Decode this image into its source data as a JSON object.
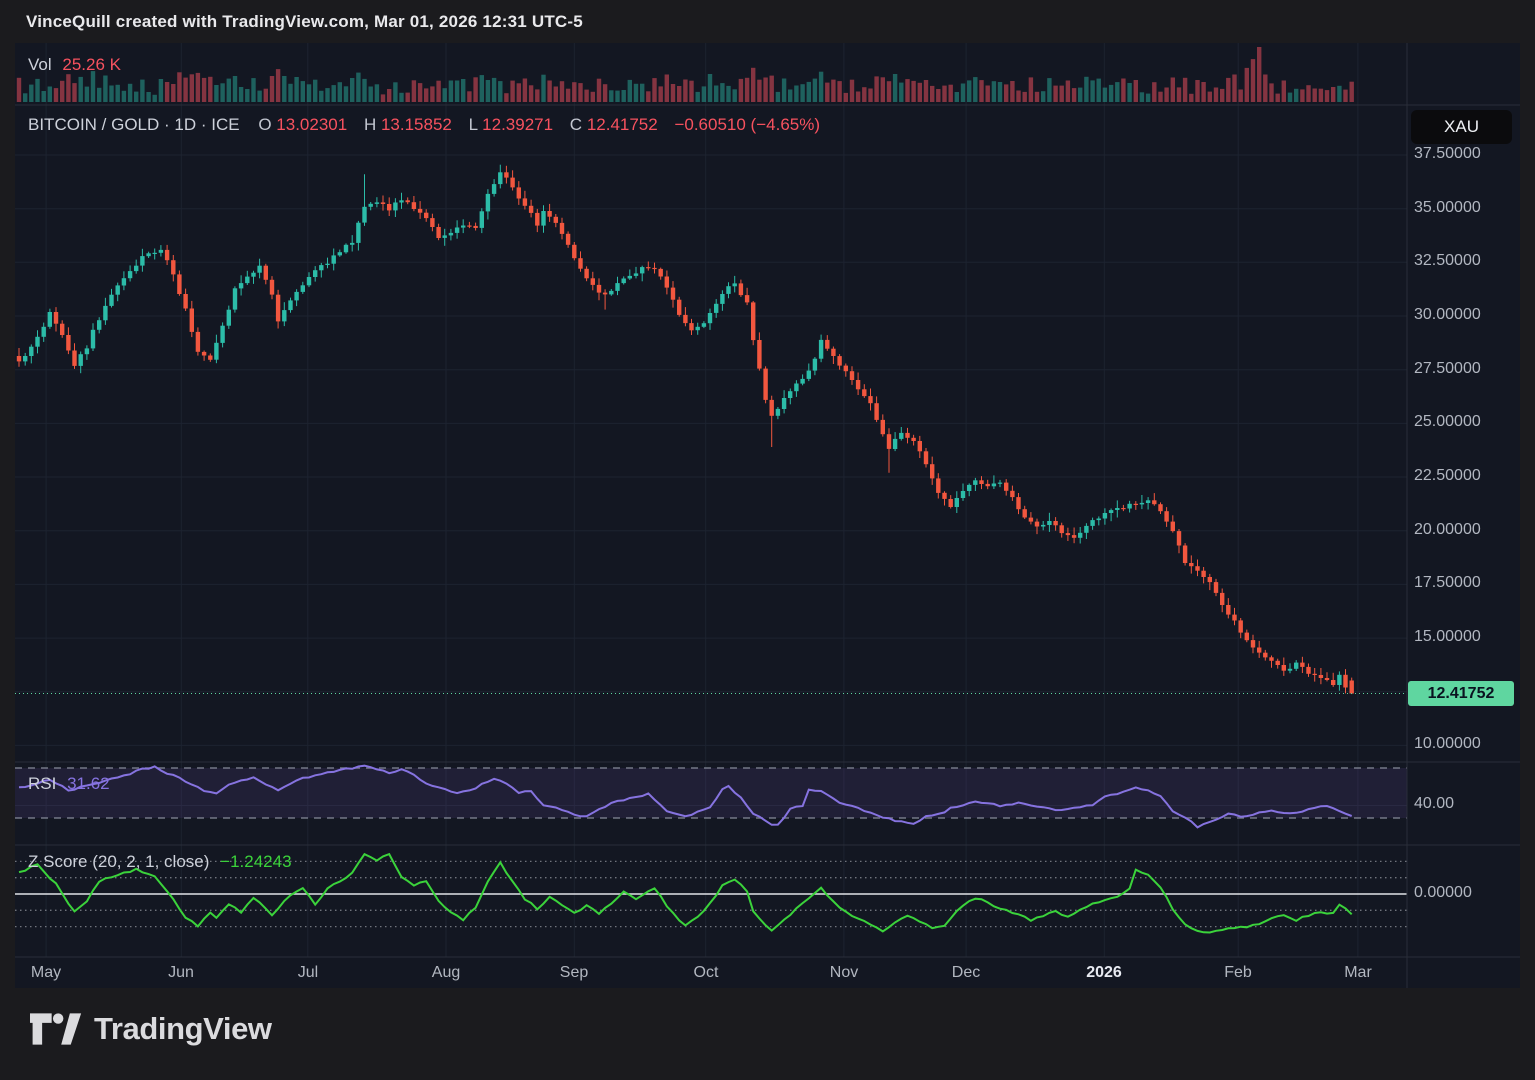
{
  "header": {
    "text": "VinceQuill created with TradingView.com, Mar 01, 2026 12:31 UTC-5"
  },
  "volume_legend": {
    "label": "Vol",
    "value": "25.26 K"
  },
  "legend": {
    "symbol_line": "BITCOIN / GOLD · 1D · ICE",
    "o_label": "O",
    "o_value": "13.02301",
    "h_label": "H",
    "h_value": "13.15852",
    "l_label": "L",
    "l_value": "12.39271",
    "c_label": "C",
    "c_value": "12.41752",
    "change_value": "−0.60510 (−4.65%)"
  },
  "rsi_legend": {
    "label": "RSI",
    "value": "31.62"
  },
  "z_legend": {
    "label": "Z Score (20, 2, 1, close)",
    "value": "−1.24243"
  },
  "axis": {
    "symbol_badge": "XAU",
    "last_price_label": "12.41752",
    "price_tick_labels": [
      "37.50000",
      "35.00000",
      "32.50000",
      "30.00000",
      "27.50000",
      "25.00000",
      "22.50000",
      "20.00000",
      "17.50000",
      "15.00000",
      "10.00000"
    ],
    "price_tick_values": [
      37.5,
      35,
      32.5,
      30,
      27.5,
      25,
      22.5,
      20,
      17.5,
      15,
      10
    ],
    "rsi_tick": "40.00",
    "z_tick": "0.00000"
  },
  "footer": {
    "brand": "TradingView"
  },
  "colors": {
    "up": "#2cbca8",
    "down": "#f2573f",
    "vol_up": "rgba(44,188,168,0.45)",
    "vol_down": "rgba(247,82,95,0.5)",
    "text_red": "#f7525f",
    "rsi_line": "#8673e0",
    "rsi_fill": "rgba(126,87,194,0.13)",
    "z_line": "#3bd33b",
    "badge_green": "#5fd6a0",
    "bg_chart": "#131722",
    "bg_outer": "#1b1b1e",
    "grid": "#1d2330",
    "separator": "#2a2e39",
    "axis_text": "#b2b7c1"
  },
  "chart_data": {
    "type": "candlestick",
    "title": "BITCOIN / GOLD, 1D, ICE",
    "quote_unit": "XAU",
    "n_candles": 217,
    "last_candle": {
      "o": 13.02301,
      "h": 13.15852,
      "l": 12.39271,
      "c": 12.41752,
      "change": -0.6051,
      "change_pct": -4.65
    },
    "visible_price_range": [
      9.2,
      39.7
    ],
    "months": {
      "labels": [
        "May",
        "Jun",
        "Jul",
        "Aug",
        "Sep",
        "Oct",
        "Nov",
        "Dec",
        "2026",
        "Feb",
        "Mar"
      ],
      "indices": [
        4.4,
        26.3,
        46.8,
        69.2,
        90.0,
        111.3,
        133.7,
        153.5,
        175.9,
        197.6,
        217.0
      ],
      "bold_label": "2026"
    },
    "close_anchors": [
      [
        0,
        27.8
      ],
      [
        2,
        28.5
      ],
      [
        5,
        30.1
      ],
      [
        7,
        29.2
      ],
      [
        9,
        27.7
      ],
      [
        11,
        28.6
      ],
      [
        13,
        29.9
      ],
      [
        15,
        31.1
      ],
      [
        18,
        32.1
      ],
      [
        20,
        32.8
      ],
      [
        23,
        33.1
      ],
      [
        25,
        31.9
      ],
      [
        27,
        30.3
      ],
      [
        29,
        28.4
      ],
      [
        31,
        27.9
      ],
      [
        33,
        29.6
      ],
      [
        35,
        31.2
      ],
      [
        37,
        31.9
      ],
      [
        39,
        32.3
      ],
      [
        41,
        30.9
      ],
      [
        42,
        29.7
      ],
      [
        44,
        30.7
      ],
      [
        46,
        31.5
      ],
      [
        49,
        32.3
      ],
      [
        52,
        33.0
      ],
      [
        54,
        33.5
      ],
      [
        56,
        35.0
      ],
      [
        58,
        35.3
      ],
      [
        60,
        35.0
      ],
      [
        62,
        35.5
      ],
      [
        64,
        34.9
      ],
      [
        66,
        34.6
      ],
      [
        68,
        33.6
      ],
      [
        70,
        33.9
      ],
      [
        72,
        34.3
      ],
      [
        74,
        34.0
      ],
      [
        76,
        35.6
      ],
      [
        78,
        36.8
      ],
      [
        80,
        35.9
      ],
      [
        82,
        35.1
      ],
      [
        84,
        34.3
      ],
      [
        85,
        34.9
      ],
      [
        87,
        34.4
      ],
      [
        89,
        33.3
      ],
      [
        91,
        32.2
      ],
      [
        93,
        31.4
      ],
      [
        95,
        30.9
      ],
      [
        97,
        31.5
      ],
      [
        99,
        31.9
      ],
      [
        101,
        32.2
      ],
      [
        103,
        32.3
      ],
      [
        105,
        31.4
      ],
      [
        107,
        30.1
      ],
      [
        109,
        29.4
      ],
      [
        111,
        29.6
      ],
      [
        113,
        30.6
      ],
      [
        115,
        31.3
      ],
      [
        116,
        31.5
      ],
      [
        118,
        30.6
      ],
      [
        119,
        28.9
      ],
      [
        120,
        27.6
      ],
      [
        121,
        26.2
      ],
      [
        122,
        25.4
      ],
      [
        124,
        26.1
      ],
      [
        126,
        26.9
      ],
      [
        128,
        27.4
      ],
      [
        130,
        28.8
      ],
      [
        132,
        28.2
      ],
      [
        134,
        27.4
      ],
      [
        136,
        26.6
      ],
      [
        138,
        25.9
      ],
      [
        140,
        24.6
      ],
      [
        141,
        23.9
      ],
      [
        143,
        24.6
      ],
      [
        145,
        24.2
      ],
      [
        147,
        23.0
      ],
      [
        149,
        21.8
      ],
      [
        151,
        21.2
      ],
      [
        153,
        21.9
      ],
      [
        155,
        22.3
      ],
      [
        157,
        22.1
      ],
      [
        159,
        22.2
      ],
      [
        161,
        21.5
      ],
      [
        163,
        20.6
      ],
      [
        165,
        20.2
      ],
      [
        167,
        20.5
      ],
      [
        169,
        19.9
      ],
      [
        171,
        19.6
      ],
      [
        173,
        20.2
      ],
      [
        175,
        20.6
      ],
      [
        177,
        20.9
      ],
      [
        179,
        21.0
      ],
      [
        181,
        21.3
      ],
      [
        183,
        21.5
      ],
      [
        185,
        20.9
      ],
      [
        187,
        19.9
      ],
      [
        189,
        18.6
      ],
      [
        191,
        18.1
      ],
      [
        193,
        17.5
      ],
      [
        195,
        16.5
      ],
      [
        197,
        15.8
      ],
      [
        199,
        14.9
      ],
      [
        201,
        14.4
      ],
      [
        203,
        13.9
      ],
      [
        205,
        13.4
      ],
      [
        207,
        13.8
      ],
      [
        209,
        13.4
      ],
      [
        211,
        13.1
      ],
      [
        213,
        12.8
      ],
      [
        214,
        13.2
      ],
      [
        215,
        12.6
      ],
      [
        216,
        12.41752
      ]
    ],
    "wick_highs": {
      "56": 36.6,
      "78": 37.05
    },
    "wick_lows": {
      "95": 30.3,
      "122": 23.9,
      "141": 22.7
    },
    "volume": {
      "label": "Vol",
      "last_value": "25.26 K",
      "spikes": {
        "15": 0.3,
        "33": 0.34,
        "56": 0.42,
        "78": 0.38,
        "90": 0.36,
        "117": 0.42,
        "122": 0.48,
        "140": 0.45,
        "160": 0.32,
        "184": 0.36,
        "191": 0.4,
        "197": 0.5,
        "199": 0.62,
        "200": 0.78,
        "201": 1.0,
        "202": 0.5
      }
    },
    "rsi": {
      "name": "RSI",
      "last": 31.62,
      "band_levels": [
        70,
        30
      ],
      "axis_tick": 40,
      "anchors": [
        [
          0,
          54
        ],
        [
          3,
          58
        ],
        [
          5,
          61
        ],
        [
          8,
          52
        ],
        [
          11,
          56
        ],
        [
          14,
          60
        ],
        [
          17,
          64
        ],
        [
          20,
          69
        ],
        [
          22,
          71
        ],
        [
          24,
          66
        ],
        [
          26,
          62
        ],
        [
          28,
          57
        ],
        [
          30,
          52
        ],
        [
          32,
          50
        ],
        [
          34,
          57
        ],
        [
          36,
          60
        ],
        [
          38,
          63
        ],
        [
          40,
          57
        ],
        [
          42,
          52
        ],
        [
          44,
          58
        ],
        [
          46,
          62
        ],
        [
          48,
          64
        ],
        [
          50,
          66
        ],
        [
          52,
          68
        ],
        [
          54,
          70
        ],
        [
          56,
          72
        ],
        [
          58,
          69
        ],
        [
          60,
          66
        ],
        [
          62,
          69
        ],
        [
          64,
          64
        ],
        [
          66,
          58
        ],
        [
          68,
          54
        ],
        [
          71,
          50
        ],
        [
          74,
          54
        ],
        [
          77,
          62
        ],
        [
          79,
          57
        ],
        [
          81,
          50
        ],
        [
          83,
          52
        ],
        [
          85,
          40
        ],
        [
          87,
          38
        ],
        [
          90,
          33
        ],
        [
          92,
          31
        ],
        [
          96,
          42
        ],
        [
          99,
          46
        ],
        [
          102,
          49
        ],
        [
          105,
          36
        ],
        [
          106,
          34
        ],
        [
          108,
          31
        ],
        [
          110,
          35
        ],
        [
          112,
          39
        ],
        [
          114,
          53
        ],
        [
          115,
          55
        ],
        [
          117,
          46
        ],
        [
          119,
          34
        ],
        [
          120,
          31
        ],
        [
          122,
          24
        ],
        [
          123,
          24
        ],
        [
          125,
          37
        ],
        [
          127,
          40
        ],
        [
          128,
          53
        ],
        [
          130,
          52
        ],
        [
          132,
          45
        ],
        [
          133,
          42
        ],
        [
          135,
          40
        ],
        [
          137,
          36
        ],
        [
          139,
          32
        ],
        [
          142,
          28
        ],
        [
          145,
          25
        ],
        [
          147,
          31
        ],
        [
          150,
          35
        ],
        [
          151,
          38
        ],
        [
          155,
          43
        ],
        [
          159,
          40
        ],
        [
          162,
          42
        ],
        [
          166,
          38
        ],
        [
          169,
          36
        ],
        [
          171,
          38
        ],
        [
          174,
          40
        ],
        [
          176,
          47
        ],
        [
          179,
          51
        ],
        [
          181,
          54
        ],
        [
          183,
          52
        ],
        [
          185,
          48
        ],
        [
          187,
          36
        ],
        [
          190,
          27
        ],
        [
          191,
          23
        ],
        [
          194,
          28
        ],
        [
          196,
          34
        ],
        [
          198,
          31
        ],
        [
          200,
          33
        ],
        [
          203,
          36
        ],
        [
          205,
          34
        ],
        [
          208,
          35
        ],
        [
          210,
          38
        ],
        [
          212,
          40
        ],
        [
          214,
          36
        ],
        [
          216,
          31.62
        ]
      ]
    },
    "zscore": {
      "name": "Z Score (20, 2, 1, close)",
      "last": -1.24243,
      "levels": [
        2,
        1,
        0,
        -1,
        -2
      ],
      "anchors": [
        [
          0,
          1.3
        ],
        [
          3,
          1.8
        ],
        [
          6,
          0.6
        ],
        [
          9,
          -1.1
        ],
        [
          11,
          -0.4
        ],
        [
          13,
          0.8
        ],
        [
          19,
          1.5
        ],
        [
          22,
          1.1
        ],
        [
          24,
          0.2
        ],
        [
          27,
          -1.4
        ],
        [
          29,
          -2.0
        ],
        [
          31,
          -1.1
        ],
        [
          32,
          -1.5
        ],
        [
          34,
          -0.6
        ],
        [
          36,
          -1.1
        ],
        [
          38,
          -0.2
        ],
        [
          41,
          -1.3
        ],
        [
          43,
          -0.4
        ],
        [
          46,
          0.4
        ],
        [
          48,
          -0.6
        ],
        [
          50,
          0.3
        ],
        [
          52,
          0.8
        ],
        [
          54,
          1.3
        ],
        [
          56,
          2.5
        ],
        [
          58,
          2.1
        ],
        [
          60,
          2.4
        ],
        [
          62,
          1.1
        ],
        [
          64,
          0.5
        ],
        [
          66,
          0.8
        ],
        [
          68,
          -0.4
        ],
        [
          70,
          -1.1
        ],
        [
          72,
          -1.6
        ],
        [
          74,
          -0.8
        ],
        [
          76,
          0.8
        ],
        [
          78,
          1.9
        ],
        [
          80,
          0.8
        ],
        [
          82,
          -0.3
        ],
        [
          84,
          -0.9
        ],
        [
          86,
          -0.2
        ],
        [
          88,
          -0.7
        ],
        [
          90,
          -1.2
        ],
        [
          92,
          -0.7
        ],
        [
          94,
          -1.2
        ],
        [
          96,
          -0.6
        ],
        [
          98,
          0.1
        ],
        [
          100,
          -0.3
        ],
        [
          103,
          0.4
        ],
        [
          105,
          -0.7
        ],
        [
          107,
          -1.6
        ],
        [
          108,
          -1.9
        ],
        [
          110,
          -1.4
        ],
        [
          112,
          -0.6
        ],
        [
          114,
          0.5
        ],
        [
          116,
          0.9
        ],
        [
          118,
          0.2
        ],
        [
          119,
          -1.0
        ],
        [
          121,
          -1.9
        ],
        [
          122,
          -2.3
        ],
        [
          124,
          -1.6
        ],
        [
          126,
          -0.9
        ],
        [
          128,
          -0.3
        ],
        [
          130,
          0.4
        ],
        [
          132,
          -0.5
        ],
        [
          134,
          -1.1
        ],
        [
          136,
          -1.5
        ],
        [
          138,
          -1.9
        ],
        [
          140,
          -2.3
        ],
        [
          142,
          -1.7
        ],
        [
          144,
          -1.3
        ],
        [
          146,
          -1.7
        ],
        [
          148,
          -2.1
        ],
        [
          150,
          -1.9
        ],
        [
          152,
          -1.0
        ],
        [
          154,
          -0.4
        ],
        [
          156,
          -0.3
        ],
        [
          158,
          -0.7
        ],
        [
          160,
          -1.0
        ],
        [
          162,
          -1.3
        ],
        [
          164,
          -1.6
        ],
        [
          166,
          -1.3
        ],
        [
          168,
          -1.1
        ],
        [
          170,
          -1.4
        ],
        [
          172,
          -1.0
        ],
        [
          174,
          -0.6
        ],
        [
          176,
          -0.4
        ],
        [
          178,
          -0.2
        ],
        [
          180,
          0.3
        ],
        [
          181,
          1.5
        ],
        [
          183,
          1.2
        ],
        [
          185,
          0.4
        ],
        [
          187,
          -0.9
        ],
        [
          189,
          -1.9
        ],
        [
          191,
          -2.3
        ],
        [
          193,
          -2.4
        ],
        [
          195,
          -2.2
        ],
        [
          197,
          -2.1
        ],
        [
          199,
          -2.0
        ],
        [
          201,
          -1.8
        ],
        [
          203,
          -1.5
        ],
        [
          205,
          -1.3
        ],
        [
          207,
          -1.6
        ],
        [
          209,
          -1.3
        ],
        [
          211,
          -1.1
        ],
        [
          213,
          -1.2
        ],
        [
          214,
          -0.7
        ],
        [
          215,
          -0.9
        ],
        [
          216,
          -1.24
        ]
      ]
    }
  }
}
